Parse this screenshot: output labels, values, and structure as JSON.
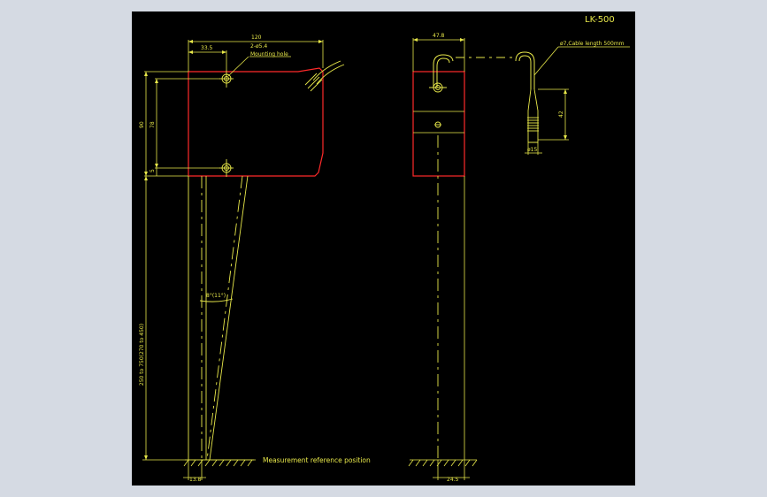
{
  "drawing": {
    "title": "LK-500",
    "colors": {
      "outline": "#ff2a2a",
      "dimension": "#e8e84a",
      "sheet": "#000000",
      "viewer_background": "#d5dae3"
    },
    "front_view": {
      "width_dim": "120",
      "hole_offset_dim": "33.5",
      "hole_callout": "2-ø5.4",
      "hole_note": "Mounting hole",
      "height_dim": "90",
      "hole_pitch_dim": "78",
      "small_offset_dim": "5",
      "range_dim": "250 to 750(270 to 450)",
      "angle_dim": "8°(11°)",
      "reference_label": "Measurement reference position",
      "bottom_dim": "13.8"
    },
    "side_view": {
      "width_dim": "47.8",
      "bottom_dim": "24.5"
    },
    "cable_view": {
      "cable_note": "ø7,Cable length 500mm",
      "connector_length_dim": "42",
      "connector_diameter_dim": "ø15"
    }
  }
}
